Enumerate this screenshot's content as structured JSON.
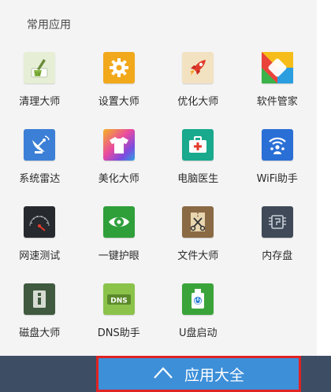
{
  "section": {
    "title": "常用应用"
  },
  "apps": [
    {
      "label": "清理大师",
      "icon": "broom-icon",
      "color": "#dbe9c2"
    },
    {
      "label": "设置大师",
      "icon": "gear-icon",
      "color": "#f2a81b"
    },
    {
      "label": "优化大师",
      "icon": "rocket-icon",
      "color": "#f3dcb4"
    },
    {
      "label": "软件管家",
      "icon": "app-store-icon",
      "color": "#e9433c"
    },
    {
      "label": "系统雷达",
      "icon": "radar-dish-icon",
      "color": "#3b7fd6"
    },
    {
      "label": "美化大师",
      "icon": "tshirt-icon",
      "color": "#e94aa0"
    },
    {
      "label": "电脑医生",
      "icon": "medical-kit-icon",
      "color": "#19a98d"
    },
    {
      "label": "WiFi助手",
      "icon": "wifi-person-icon",
      "color": "#2a6fd6"
    },
    {
      "label": "网速测试",
      "icon": "speedometer-icon",
      "color": "#26292e"
    },
    {
      "label": "一键护眼",
      "icon": "eye-icon",
      "color": "#2f9f3a"
    },
    {
      "label": "文件大师",
      "icon": "scissors-file-icon",
      "color": "#8a6a44"
    },
    {
      "label": "内存盘",
      "icon": "memory-chip-icon",
      "color": "#3f4957"
    },
    {
      "label": "磁盘大师",
      "icon": "disk-icon",
      "color": "#3f5a3f"
    },
    {
      "label": "DNS助手",
      "icon": "dns-icon",
      "color": "#8bc34a"
    },
    {
      "label": "U盘启动",
      "icon": "usb-power-icon",
      "color": "#3aa43a"
    }
  ],
  "footer": {
    "button_label": "应用大全",
    "button_icon": "up-arrow-icon",
    "accent": "#3d8fd8",
    "bar_color": "#3d4d64"
  }
}
